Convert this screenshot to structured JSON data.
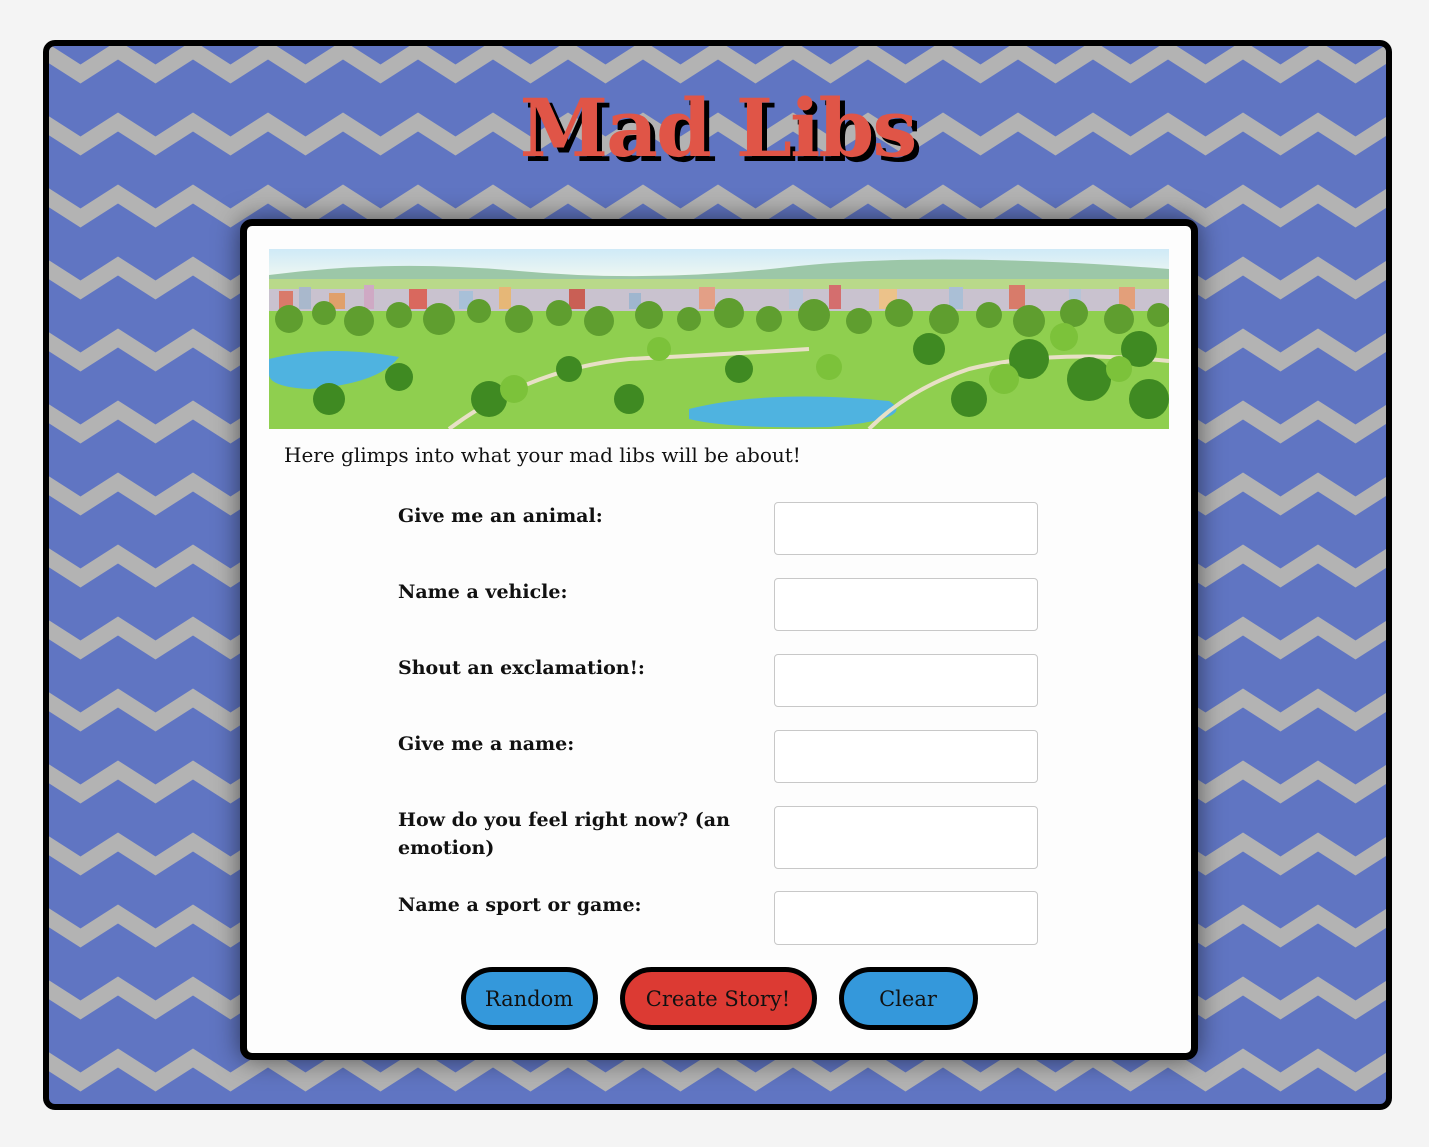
{
  "title": "Mad Libs",
  "intro_text": "Here glimps into what your mad libs will be about!",
  "form": {
    "fields": [
      {
        "label": "Give me an animal:",
        "value": ""
      },
      {
        "label": "Name a vehicle:",
        "value": ""
      },
      {
        "label": "Shout an exclamation!:",
        "value": ""
      },
      {
        "label": "Give me a name:",
        "value": ""
      },
      {
        "label": "How do you feel right now? (an emotion)",
        "value": ""
      },
      {
        "label": "Name a sport or game:",
        "value": ""
      }
    ]
  },
  "buttons": {
    "random_label": "Random",
    "create_label": "Create Story!",
    "clear_label": "Clear"
  },
  "colors": {
    "background_blue": "#6075c2",
    "chevron_gray": "#b3b3b3",
    "title_red": "#e05547",
    "button_blue": "#3498db",
    "button_red": "#dc3a33"
  },
  "banner_image": "park-cityscape-illustration"
}
